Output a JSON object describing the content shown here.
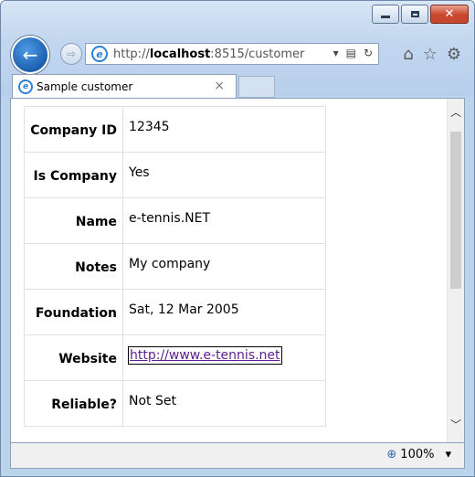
{
  "browser": {
    "address_url_prefix": "http://",
    "address_url_host": "localhost",
    "address_url_rest": ":8515/customer",
    "tab_title": "Sample customer",
    "zoom_level": "100%"
  },
  "record": {
    "rows": [
      {
        "label": "Company ID",
        "value": "12345"
      },
      {
        "label": "Is Company",
        "value": "Yes"
      },
      {
        "label": "Name",
        "value": "e-tennis.NET"
      },
      {
        "label": "Notes",
        "value": "My company"
      },
      {
        "label": "Foundation",
        "value": "Sat, 12 Mar 2005"
      },
      {
        "label": "Website",
        "value": "http://www.e-tennis.net"
      },
      {
        "label": "Reliable?",
        "value": "Not Set"
      }
    ]
  },
  "icons": {
    "back": "back-arrow-icon",
    "forward": "forward-arrow-icon",
    "home": "home-icon",
    "favorites": "star-icon",
    "tools": "gear-icon"
  }
}
